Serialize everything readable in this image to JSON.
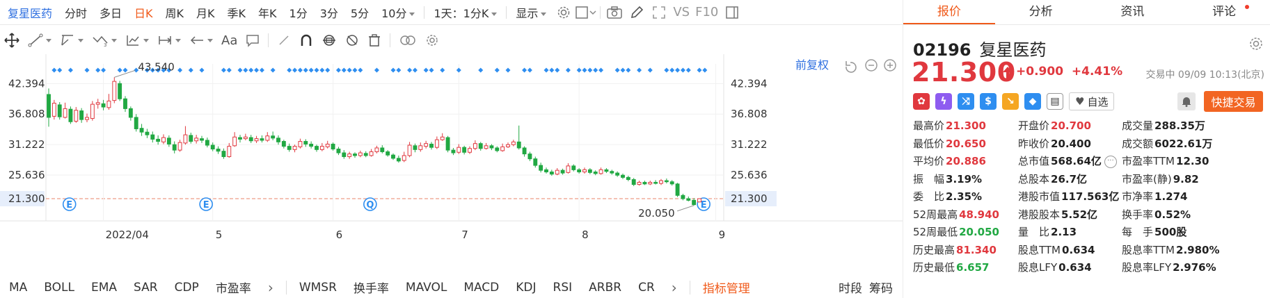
{
  "top_tabs": {
    "brand": "复星医药",
    "periods": [
      "分时",
      "多日",
      "日K",
      "周K",
      "月K",
      "季K",
      "年K",
      "1分",
      "3分",
      "5分",
      "10分"
    ],
    "active_period": "日K",
    "interval_select": "1天：1分K",
    "display_label": "显示",
    "vs_label": "VS",
    "f10_label": "F10"
  },
  "toolbar": {
    "text_tool": "Aa"
  },
  "chart": {
    "fq_label": "前复权",
    "y_labels_left": [
      "42.394",
      "36.808",
      "31.222",
      "25.636",
      "21.300"
    ],
    "y_labels_right": [
      "42.394",
      "36.808",
      "31.222",
      "25.636",
      "21.300"
    ],
    "x_labels": [
      "2022/04",
      "5",
      "6",
      "7",
      "8",
      "9"
    ],
    "high_annotation": "43.540",
    "low_annotation": "20.050",
    "current_price": "21.300",
    "event_marks": [
      "E",
      "E",
      "Q",
      "E"
    ]
  },
  "indicators": {
    "items": [
      "MA",
      "BOLL",
      "EMA",
      "SAR",
      "CDP",
      "市盈率",
      "WMSR",
      "换手率",
      "MAVOL",
      "MACD",
      "KDJ",
      "RSI",
      "ARBR",
      "CR"
    ],
    "manage_label": "指标管理",
    "time_period": "时段",
    "chips_label": "筹码"
  },
  "right_panel": {
    "tabs": [
      "报价",
      "分析",
      "资讯",
      "评论"
    ],
    "active_tab": "报价",
    "code": "02196",
    "name": "复星医药",
    "price": "21.300",
    "change": "+0.900",
    "change_pct": "+4.41%",
    "status": "交易中 09/09 10:13(北京)",
    "add_fav_label": "自选",
    "quick_trade_label": "快捷交易",
    "colors": {
      "up": "#e0383e",
      "down": "#21a843",
      "accent": "#f05a1a",
      "button": "#f26522"
    },
    "quote_rows": [
      [
        {
          "k": "最高价",
          "v": "21.300",
          "c": "red"
        },
        {
          "k": "开盘价",
          "v": "20.700",
          "c": "red"
        },
        {
          "k": "成交量",
          "v": "288.35万",
          "c": "dark"
        }
      ],
      [
        {
          "k": "最低价",
          "v": "20.650",
          "c": "red"
        },
        {
          "k": "昨收价",
          "v": "20.400",
          "c": "dark"
        },
        {
          "k": "成交额",
          "v": "6022.61万",
          "c": "dark"
        }
      ],
      [
        {
          "k": "平均价",
          "v": "20.886",
          "c": "red"
        },
        {
          "k": "总市值",
          "v": "568.64亿",
          "c": "dark"
        },
        {
          "k": "市盈率TTM",
          "v": "12.30",
          "c": "dark"
        }
      ],
      [
        {
          "k": "振　幅",
          "v": "3.19%",
          "c": "dark"
        },
        {
          "k": "总股本",
          "v": "26.7亿",
          "c": "dark"
        },
        {
          "k": "市盈率(静)",
          "v": "9.82",
          "c": "dark"
        }
      ],
      [
        {
          "k": "委　比",
          "v": "2.35%",
          "c": "dark"
        },
        {
          "k": "港股市值",
          "v": "117.563亿",
          "c": "dark"
        },
        {
          "k": "市净率",
          "v": "1.274",
          "c": "dark"
        }
      ],
      [
        {
          "k": "52周最高",
          "v": "48.940",
          "c": "red"
        },
        {
          "k": "港股股本",
          "v": "5.52亿",
          "c": "dark"
        },
        {
          "k": "换手率",
          "v": "0.52%",
          "c": "dark"
        }
      ],
      [
        {
          "k": "52周最低",
          "v": "20.050",
          "c": "green"
        },
        {
          "k": "量　比",
          "v": "2.13",
          "c": "dark"
        },
        {
          "k": "每　手",
          "v": "500股",
          "c": "dark"
        }
      ],
      [
        {
          "k": "历史最高",
          "v": "81.340",
          "c": "red"
        },
        {
          "k": "股息TTM",
          "v": "0.634",
          "c": "dark"
        },
        {
          "k": "股息率TTM",
          "v": "2.980%",
          "c": "dark"
        }
      ],
      [
        {
          "k": "历史最低",
          "v": "6.657",
          "c": "green"
        },
        {
          "k": "股息LFY",
          "v": "0.634",
          "c": "dark"
        },
        {
          "k": "股息率LFY",
          "v": "2.976%",
          "c": "dark"
        }
      ]
    ]
  },
  "chart_data": {
    "type": "candlestick",
    "symbol": "02196",
    "ylim": [
      18.5,
      46.0
    ],
    "reference_price": 21.3,
    "x_month_labels": [
      {
        "label": "2022/04",
        "index": 10
      },
      {
        "label": "5",
        "index": 30
      },
      {
        "label": "6",
        "index": 52
      },
      {
        "label": "7",
        "index": 75
      },
      {
        "label": "8",
        "index": 97
      },
      {
        "label": "9",
        "index": 122
      }
    ],
    "candles": [
      [
        40.4,
        36.2,
        41.5,
        34.5
      ],
      [
        36.4,
        38.8,
        39.4,
        35.8
      ],
      [
        38.5,
        36.3,
        39.0,
        35.8
      ],
      [
        36.2,
        37.8,
        38.9,
        36.0
      ],
      [
        37.7,
        35.4,
        38.2,
        35.0
      ],
      [
        35.5,
        37.5,
        38.1,
        35.2
      ],
      [
        37.4,
        35.8,
        37.9,
        35.2
      ],
      [
        35.8,
        36.2,
        36.9,
        35.3
      ],
      [
        36.0,
        38.6,
        39.2,
        35.6
      ],
      [
        38.6,
        38.9,
        39.6,
        37.8
      ],
      [
        38.7,
        38.1,
        39.4,
        37.5
      ],
      [
        38.0,
        39.2,
        40.5,
        37.6
      ],
      [
        39.3,
        42.8,
        43.54,
        38.8
      ],
      [
        42.4,
        39.6,
        42.9,
        39.2
      ],
      [
        39.6,
        37.8,
        40.1,
        37.2
      ],
      [
        37.8,
        36.2,
        38.2,
        35.6
      ],
      [
        36.2,
        34.1,
        36.8,
        33.6
      ],
      [
        34.2,
        33.5,
        35.0,
        32.8
      ],
      [
        33.5,
        33.0,
        34.1,
        32.4
      ],
      [
        33.0,
        32.2,
        33.6,
        31.6
      ],
      [
        32.2,
        31.8,
        32.9,
        31.2
      ],
      [
        31.7,
        32.5,
        33.1,
        31.3
      ],
      [
        32.4,
        31.3,
        32.9,
        30.8
      ],
      [
        31.2,
        30.2,
        31.8,
        29.6
      ],
      [
        30.2,
        31.6,
        32.1,
        29.9
      ],
      [
        31.5,
        33.0,
        34.6,
        31.2
      ],
      [
        32.9,
        31.8,
        33.4,
        31.4
      ],
      [
        31.9,
        32.4,
        33.0,
        31.4
      ],
      [
        32.3,
        32.0,
        32.8,
        31.5
      ],
      [
        32.0,
        31.1,
        32.5,
        30.7
      ],
      [
        31.1,
        30.4,
        31.6,
        30.0
      ],
      [
        30.4,
        30.0,
        30.9,
        29.5
      ],
      [
        30.0,
        29.0,
        30.5,
        28.6
      ],
      [
        29.0,
        30.9,
        31.5,
        28.8
      ],
      [
        31.0,
        32.6,
        33.5,
        30.8
      ],
      [
        32.5,
        32.2,
        33.0,
        31.6
      ],
      [
        32.3,
        32.6,
        33.2,
        32.0
      ],
      [
        32.5,
        31.9,
        33.0,
        31.5
      ],
      [
        31.9,
        32.3,
        32.8,
        31.5
      ],
      [
        32.3,
        32.0,
        32.9,
        31.6
      ],
      [
        32.0,
        32.8,
        33.5,
        31.7
      ],
      [
        32.8,
        32.4,
        33.6,
        32.0
      ],
      [
        32.4,
        31.7,
        32.9,
        31.2
      ],
      [
        31.8,
        30.9,
        32.1,
        30.5
      ],
      [
        30.9,
        30.3,
        31.4,
        29.9
      ],
      [
        30.3,
        30.9,
        31.2,
        29.8
      ],
      [
        30.8,
        31.8,
        32.3,
        30.5
      ],
      [
        31.8,
        31.3,
        32.2,
        30.8
      ],
      [
        31.3,
        30.9,
        31.8,
        30.5
      ],
      [
        30.9,
        30.3,
        31.2,
        29.9
      ],
      [
        30.3,
        30.9,
        31.5,
        30.0
      ],
      [
        30.8,
        31.3,
        31.9,
        30.5
      ],
      [
        31.3,
        30.4,
        31.6,
        30.1
      ],
      [
        30.4,
        29.7,
        30.8,
        29.3
      ],
      [
        29.7,
        29.0,
        30.2,
        28.6
      ],
      [
        29.0,
        29.5,
        29.9,
        28.6
      ],
      [
        29.5,
        29.2,
        29.8,
        28.8
      ],
      [
        29.2,
        29.7,
        30.1,
        28.9
      ],
      [
        29.6,
        29.2,
        30.0,
        28.9
      ],
      [
        29.2,
        29.9,
        30.4,
        29.0
      ],
      [
        29.9,
        30.6,
        31.0,
        29.6
      ],
      [
        30.6,
        29.9,
        31.1,
        29.6
      ],
      [
        29.9,
        29.3,
        30.2,
        29.0
      ],
      [
        29.3,
        28.7,
        29.6,
        28.4
      ],
      [
        28.7,
        28.2,
        29.2,
        27.9
      ],
      [
        28.3,
        29.2,
        29.9,
        28.0
      ],
      [
        29.2,
        31.1,
        31.7,
        28.9
      ],
      [
        31.0,
        30.3,
        31.4,
        29.8
      ],
      [
        30.3,
        31.0,
        31.6,
        29.9
      ],
      [
        30.9,
        31.4,
        31.9,
        30.5
      ],
      [
        31.3,
        30.7,
        31.7,
        30.3
      ],
      [
        30.7,
        32.1,
        32.7,
        30.4
      ],
      [
        32.1,
        32.6,
        33.3,
        31.9
      ],
      [
        32.5,
        30.2,
        32.8,
        29.8
      ],
      [
        30.2,
        29.7,
        30.6,
        29.3
      ],
      [
        29.8,
        30.7,
        31.3,
        29.5
      ],
      [
        30.7,
        29.8,
        31.0,
        29.4
      ],
      [
        29.8,
        30.5,
        30.9,
        29.5
      ],
      [
        30.5,
        31.4,
        32.0,
        30.2
      ],
      [
        31.4,
        30.5,
        31.7,
        30.1
      ],
      [
        30.5,
        31.0,
        31.5,
        30.3
      ],
      [
        31.0,
        30.6,
        31.3,
        30.2
      ],
      [
        30.6,
        30.1,
        30.9,
        29.8
      ],
      [
        30.1,
        30.8,
        31.4,
        29.9
      ],
      [
        30.8,
        31.2,
        31.6,
        30.6
      ],
      [
        31.2,
        31.7,
        32.1,
        30.9
      ],
      [
        31.7,
        30.6,
        34.7,
        30.3
      ],
      [
        30.6,
        29.5,
        30.9,
        29.0
      ],
      [
        29.5,
        28.6,
        29.9,
        28.2
      ],
      [
        28.6,
        27.4,
        29.0,
        27.0
      ],
      [
        27.4,
        26.5,
        27.9,
        26.1
      ],
      [
        26.6,
        26.2,
        27.0,
        25.9
      ],
      [
        26.2,
        25.8,
        26.6,
        25.5
      ],
      [
        25.8,
        26.5,
        26.9,
        25.6
      ],
      [
        26.5,
        26.0,
        26.8,
        25.7
      ],
      [
        26.1,
        27.3,
        27.8,
        25.9
      ],
      [
        27.3,
        26.6,
        27.6,
        26.3
      ],
      [
        26.6,
        26.2,
        26.9,
        25.9
      ],
      [
        26.2,
        26.6,
        27.0,
        25.9
      ],
      [
        26.6,
        26.1,
        26.9,
        25.8
      ],
      [
        26.2,
        25.9,
        26.5,
        25.6
      ],
      [
        25.9,
        26.6,
        27.0,
        25.7
      ],
      [
        26.6,
        26.3,
        26.9,
        26.0
      ],
      [
        26.3,
        26.0,
        26.6,
        25.7
      ],
      [
        26.0,
        25.6,
        26.3,
        25.3
      ],
      [
        25.6,
        25.2,
        25.9,
        24.9
      ],
      [
        25.2,
        24.8,
        25.5,
        24.5
      ],
      [
        24.8,
        23.9,
        25.1,
        23.6
      ],
      [
        23.9,
        24.3,
        24.6,
        23.7
      ],
      [
        24.3,
        24.0,
        24.6,
        23.8
      ],
      [
        24.0,
        24.3,
        24.6,
        23.8
      ],
      [
        24.3,
        24.1,
        24.7,
        23.9
      ],
      [
        24.1,
        24.6,
        24.9,
        23.8
      ],
      [
        24.6,
        24.4,
        25.0,
        24.1
      ],
      [
        24.4,
        24.0,
        24.7,
        23.7
      ],
      [
        24.0,
        21.9,
        24.2,
        21.6
      ],
      [
        21.9,
        21.3,
        22.2,
        21.0
      ],
      [
        21.3,
        21.0,
        21.7,
        20.8
      ],
      [
        21.0,
        20.2,
        21.4,
        20.05
      ],
      [
        20.7,
        21.3,
        21.3,
        20.65
      ]
    ],
    "event_indices": [
      2,
      27,
      57,
      118
    ],
    "event_marks": [
      "E",
      "E",
      "Q",
      "E"
    ],
    "marker_indices": [
      1,
      2,
      4,
      7,
      9,
      10,
      13,
      14,
      16,
      18,
      19,
      20,
      21,
      22,
      24,
      26,
      28,
      32,
      33,
      35,
      36,
      37,
      38,
      39,
      41,
      44,
      45,
      46,
      47,
      48,
      49,
      50,
      51,
      53,
      54,
      55,
      56,
      57,
      60,
      63,
      64,
      66,
      67,
      69,
      70,
      72,
      75,
      79,
      82,
      84,
      87,
      88,
      91,
      92,
      93,
      95,
      97,
      98,
      99,
      100,
      101,
      104,
      105,
      106,
      108,
      110,
      113,
      114,
      115,
      116,
      117,
      119,
      120
    ]
  }
}
